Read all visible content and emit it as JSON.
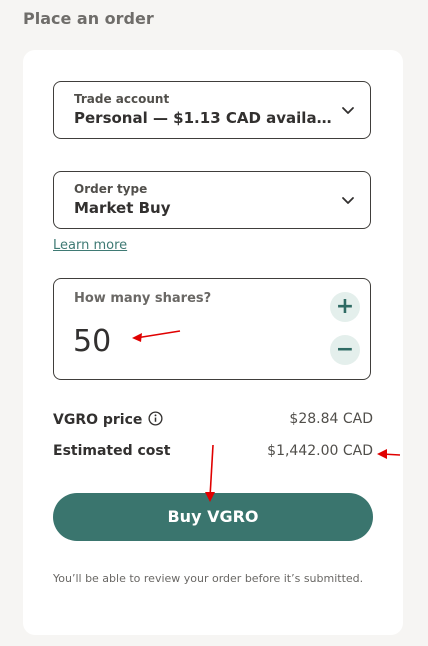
{
  "page": {
    "title": "Place an order"
  },
  "trade_account": {
    "label": "Trade account",
    "value": "Personal — $1.13 CAD availa…"
  },
  "order_type": {
    "label": "Order type",
    "value": "Market Buy",
    "learn_more": "Learn more"
  },
  "shares": {
    "label": "How many shares?",
    "value": "50",
    "increment": "+",
    "decrement": "−"
  },
  "summary": {
    "price_label": "VGRO price",
    "price_value": "$28.84 CAD",
    "cost_label": "Estimated cost",
    "cost_value": "$1,442.00 CAD"
  },
  "actions": {
    "buy_label": "Buy VGRO"
  },
  "footer": {
    "note": "You’ll be able to review your order before it’s submitted."
  },
  "colors": {
    "accent": "#3a756e",
    "annotation": "#e00000",
    "link": "#3f7a74"
  },
  "icons": [
    "chevron-down-icon",
    "info-icon",
    "plus-icon",
    "minus-icon",
    "red-arrow-icon"
  ]
}
